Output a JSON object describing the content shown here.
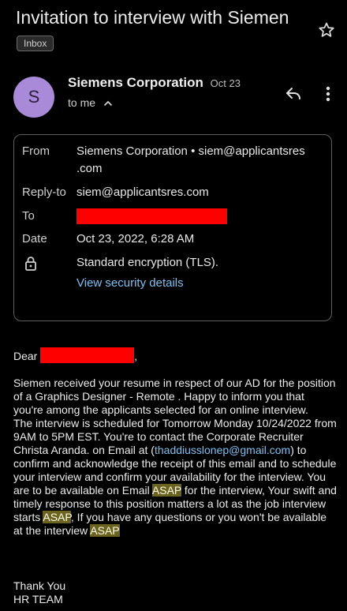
{
  "subject": "Invitation to interview with Siemen",
  "label_chip": "Inbox",
  "sender": {
    "avatar_letter": "S",
    "name": "Siemens Corporation",
    "date": "Oct 23",
    "to_me": "to me"
  },
  "details": {
    "from_label": "From",
    "from_value_line1": "Siemens Corporation • siem@applicantsres",
    "from_value_line2": ".com",
    "replyto_label": "Reply-to",
    "replyto_value": "siem@applicantsres.com",
    "to_label": "To",
    "date_label": "Date",
    "date_value": "Oct 23, 2022, 6:28 AM",
    "encryption_value": "Standard encryption (TLS).",
    "security_link": "View security details"
  },
  "body": {
    "dear": "Dear",
    "dear_comma": ",",
    "p1": "Siemen received your resume in respect of our AD for the position of a Graphics Designer - Remote . Happy to inform you that you're among the applicants selected for an online interview.",
    "p2a": "The interview is scheduled for Tomorrow Monday 10/24/2022 from 9AM to 5PM EST. You're to contact the Corporate Recruiter Christa Aranda. on Email at (",
    "email": "thaddiusslonep@gmail.com",
    "p2b": ") to confirm and acknowledge the receipt of this email and to schedule your interview and confirm your availability for the interview. You are to be available on Email ",
    "asap1": "ASAP",
    "p2c": " for the interview, Your swift and timely response to this position matters a lot as the job interview starts ",
    "asap2": "ASAP",
    "p2d": ", If you have any questions or you won't be available at the interview ",
    "asap3": "ASAP",
    "sign1": "Thank You",
    "sign2": "HR TEAM"
  },
  "colors": {
    "background": "#000000",
    "avatar": "#a98ad8",
    "link": "#7cc1f1",
    "highlight": "#6b6420",
    "redaction": "#ff0000"
  },
  "icons": [
    "star-icon",
    "reply-icon",
    "more-vert-icon",
    "chevron-up-icon",
    "lock-icon"
  ]
}
